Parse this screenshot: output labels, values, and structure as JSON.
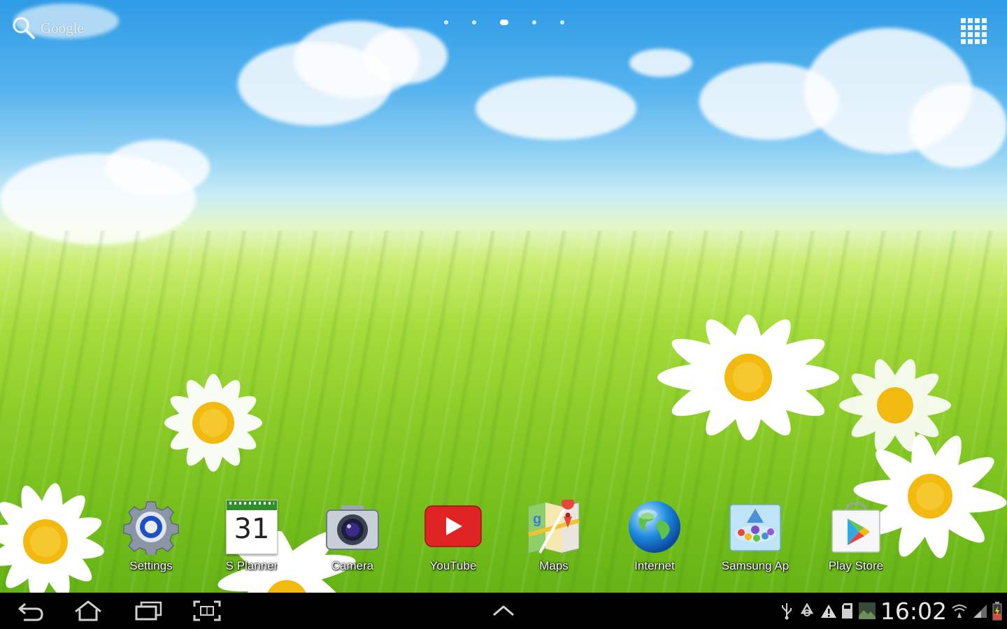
{
  "search": {
    "label": "Google"
  },
  "pager": {
    "pages": 5,
    "active_index": 2
  },
  "dock": {
    "apps": [
      {
        "label": "Settings",
        "icon": "settings-gear-icon"
      },
      {
        "label": "S Planner",
        "icon": "calendar-icon",
        "date": "31"
      },
      {
        "label": "Camera",
        "icon": "camera-icon"
      },
      {
        "label": "YouTube",
        "icon": "youtube-icon"
      },
      {
        "label": "Maps",
        "icon": "maps-icon"
      },
      {
        "label": "Internet",
        "icon": "globe-icon"
      },
      {
        "label": "Samsung Ap",
        "icon": "samsung-apps-icon"
      },
      {
        "label": "Play Store",
        "icon": "play-store-icon"
      }
    ]
  },
  "navbar": {
    "buttons": [
      "back-icon",
      "home-icon",
      "recent-apps-icon",
      "screenshot-icon",
      "up-arrow-icon"
    ],
    "status": {
      "time": "16:02",
      "icons": [
        "usb-icon",
        "recycle-icon",
        "warning-icon",
        "sd-card-icon",
        "image-icon",
        "wifi-icon",
        "signal-icon",
        "battery-icon"
      ]
    }
  },
  "colors": {
    "sky_top": "#2f9be6",
    "grass": "#8ccc28",
    "navbar": "#000000",
    "youtube_red": "#e02424",
    "daisy_center": "#f2b90f"
  }
}
